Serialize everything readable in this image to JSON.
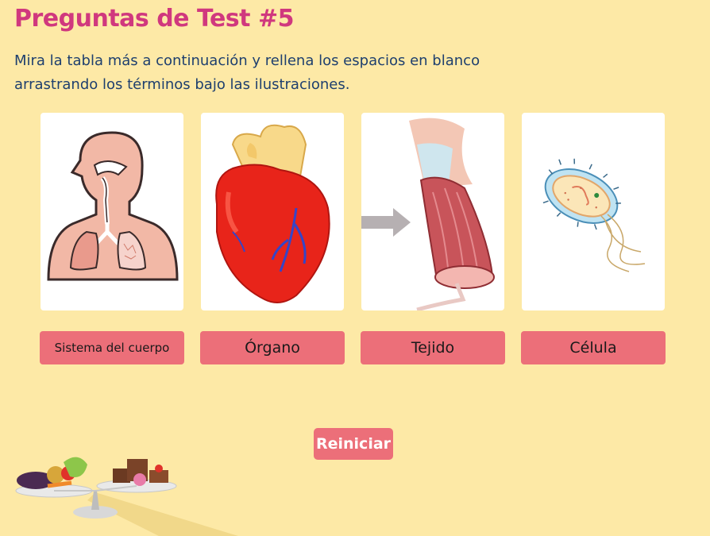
{
  "page": {
    "title": "Preguntas de Test #5",
    "instructions": "Mira la tabla más a continuación y rellena los espacios en blanco arrastrando los términos bajo las ilustraciones."
  },
  "cards": [
    {
      "illustration": "respiratory-system"
    },
    {
      "illustration": "heart"
    },
    {
      "illustration": "muscle-tissue"
    },
    {
      "illustration": "bacterial-cell"
    }
  ],
  "terms": [
    {
      "label": "Sistema del cuerpo"
    },
    {
      "label": "Órgano"
    },
    {
      "label": "Tejido"
    },
    {
      "label": "Célula"
    }
  ],
  "controls": {
    "reset_label": "Reiniciar"
  },
  "colors": {
    "background": "#fde9a6",
    "title": "#d0387e",
    "instructions": "#1e3f6e",
    "term_button": "#ec6f79"
  }
}
